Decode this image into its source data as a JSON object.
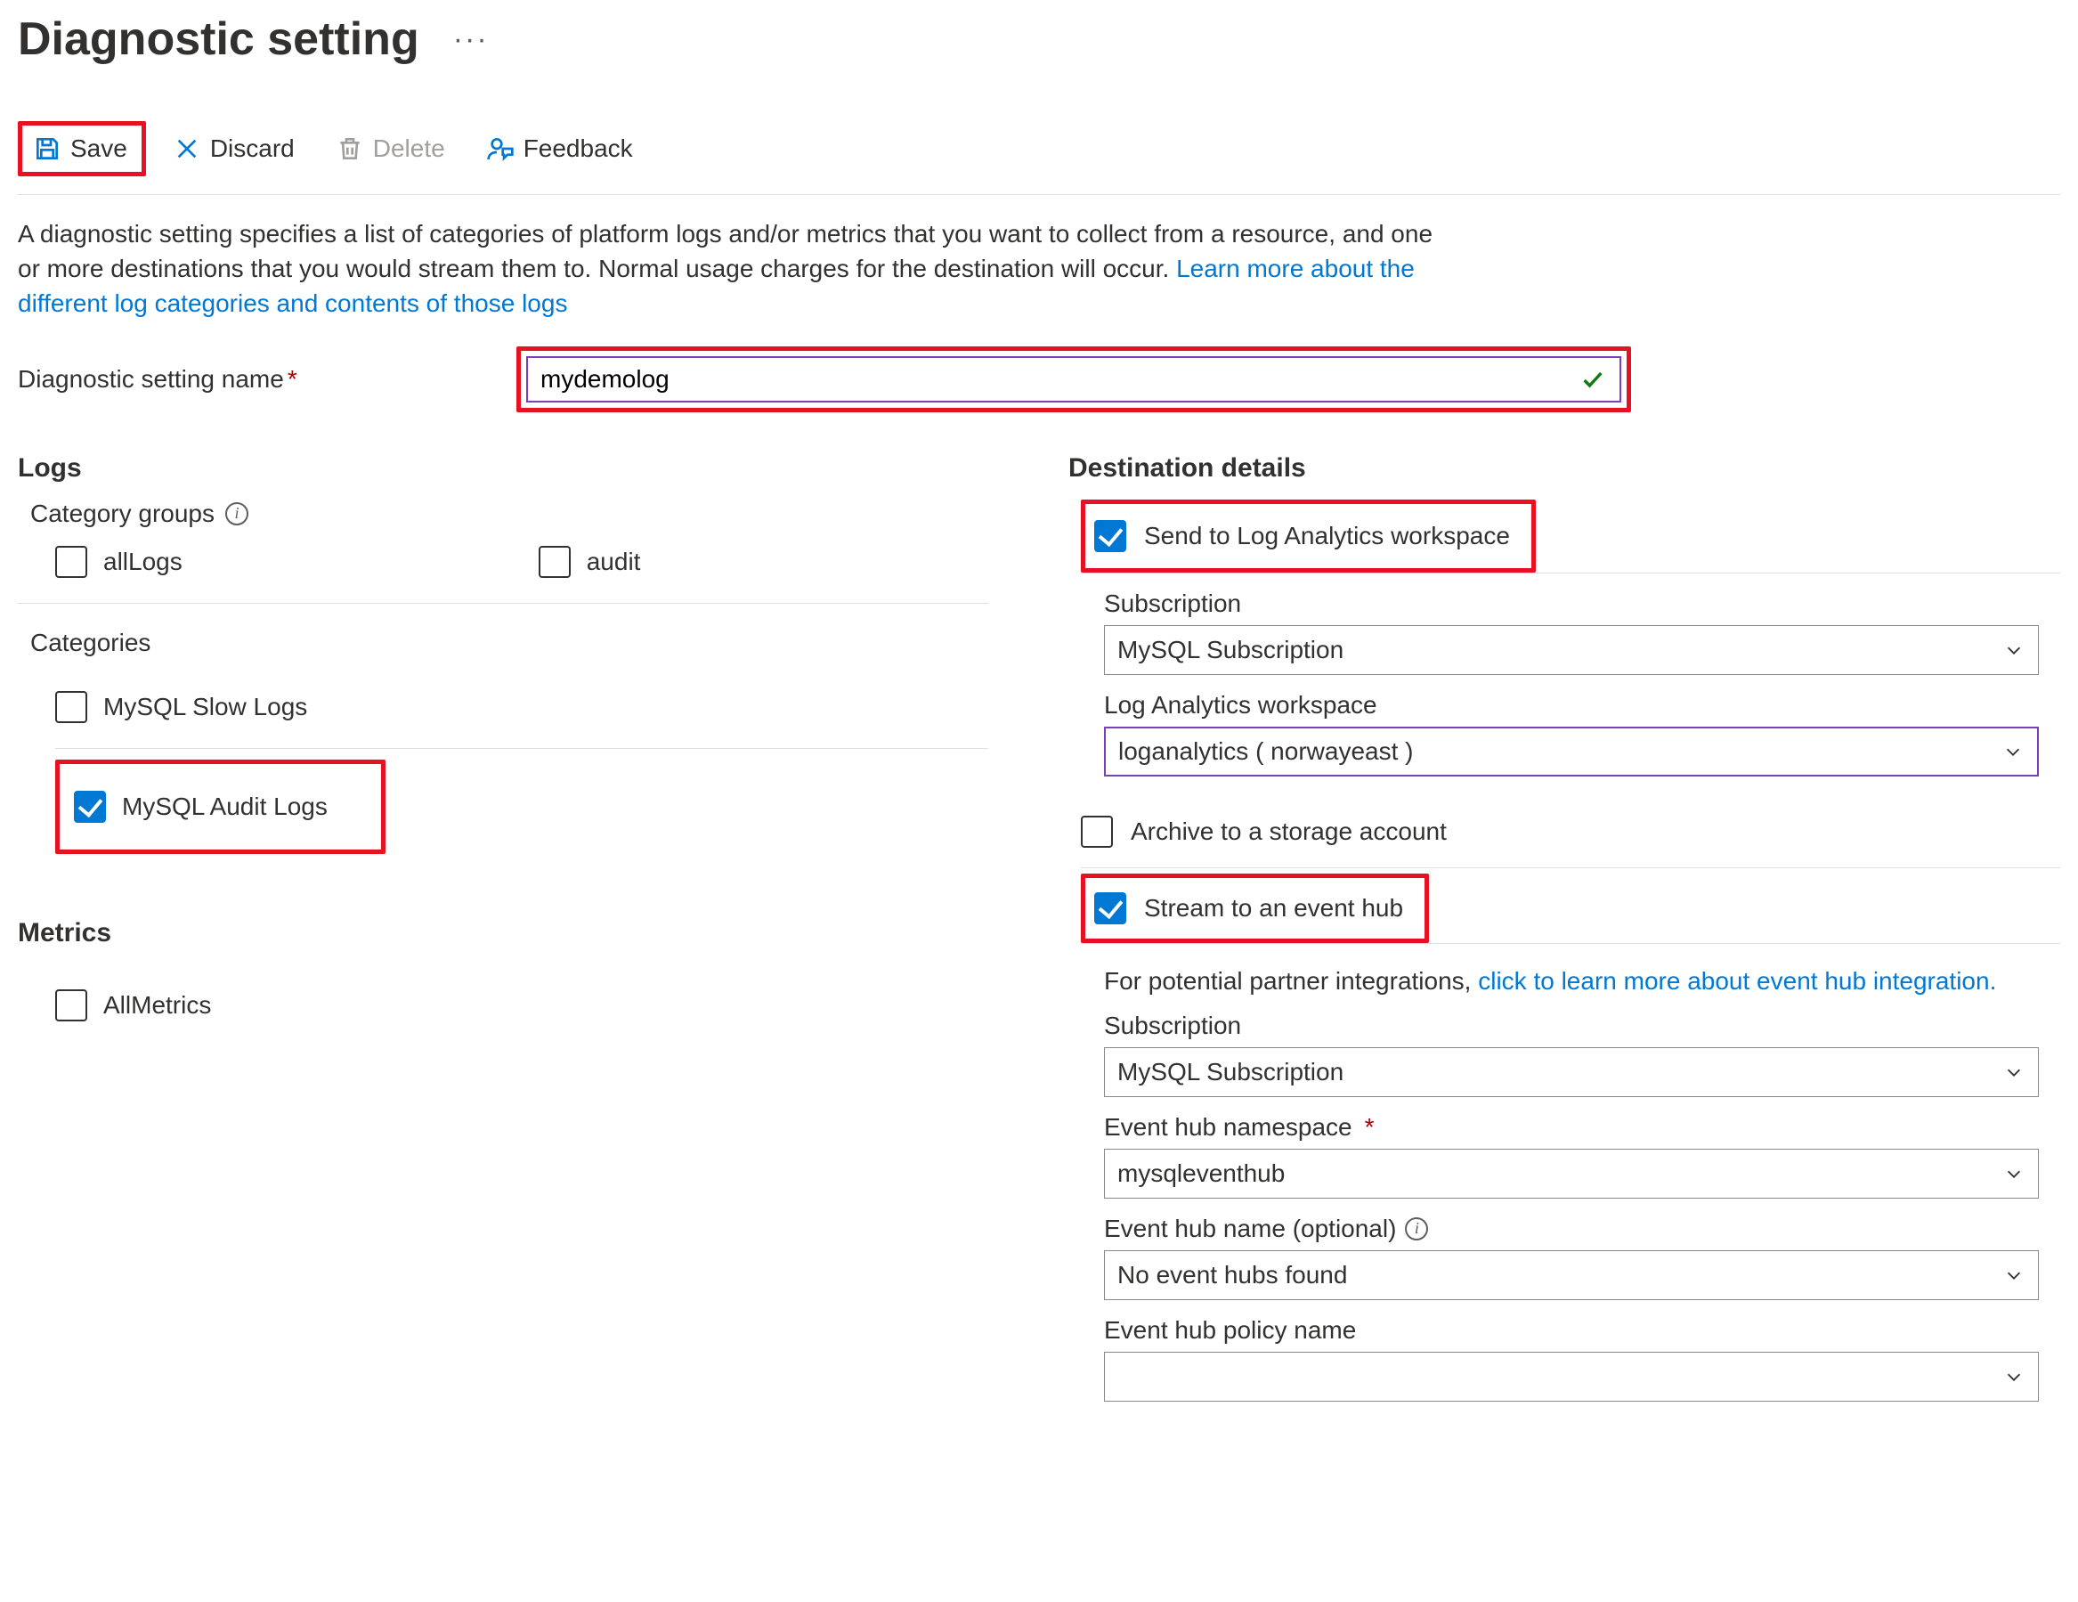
{
  "header": {
    "title": "Diagnostic setting",
    "more_label": "···"
  },
  "toolbar": {
    "save": "Save",
    "discard": "Discard",
    "delete": "Delete",
    "feedback": "Feedback"
  },
  "help": {
    "text1": "A diagnostic setting specifies a list of categories of platform logs and/or metrics that you want to collect from a resource, and one or more destinations that you would stream them to. Normal usage charges for the destination will occur. ",
    "link": "Learn more about the different log categories and contents of those logs"
  },
  "name_field": {
    "label": "Diagnostic setting name",
    "value": "mydemolog"
  },
  "logs": {
    "heading": "Logs",
    "cat_groups_label": "Category groups",
    "all_logs": "allLogs",
    "audit": "audit",
    "categories_label": "Categories",
    "slow": "MySQL Slow Logs",
    "audit_logs": "MySQL Audit Logs"
  },
  "metrics": {
    "heading": "Metrics",
    "all": "AllMetrics"
  },
  "dest": {
    "heading": "Destination details",
    "law": "Send to Log Analytics workspace",
    "archive": "Archive to a storage account",
    "eventhub": "Stream to an event hub",
    "subscription_label": "Subscription",
    "subscription_value": "MySQL Subscription",
    "law_label": "Log Analytics workspace",
    "law_value": "loganalytics ( norwayeast )",
    "partner_prefix": "For potential partner integrations, ",
    "partner_link": "click to learn more about event hub integration.",
    "eh_subscription_label": "Subscription",
    "eh_subscription_value": "MySQL Subscription",
    "eh_ns_label": "Event hub namespace",
    "eh_ns_value": "mysqleventhub",
    "eh_name_label": "Event hub name (optional)",
    "eh_name_value": "No event hubs found",
    "eh_policy_label": "Event hub policy name",
    "eh_policy_value": ""
  }
}
